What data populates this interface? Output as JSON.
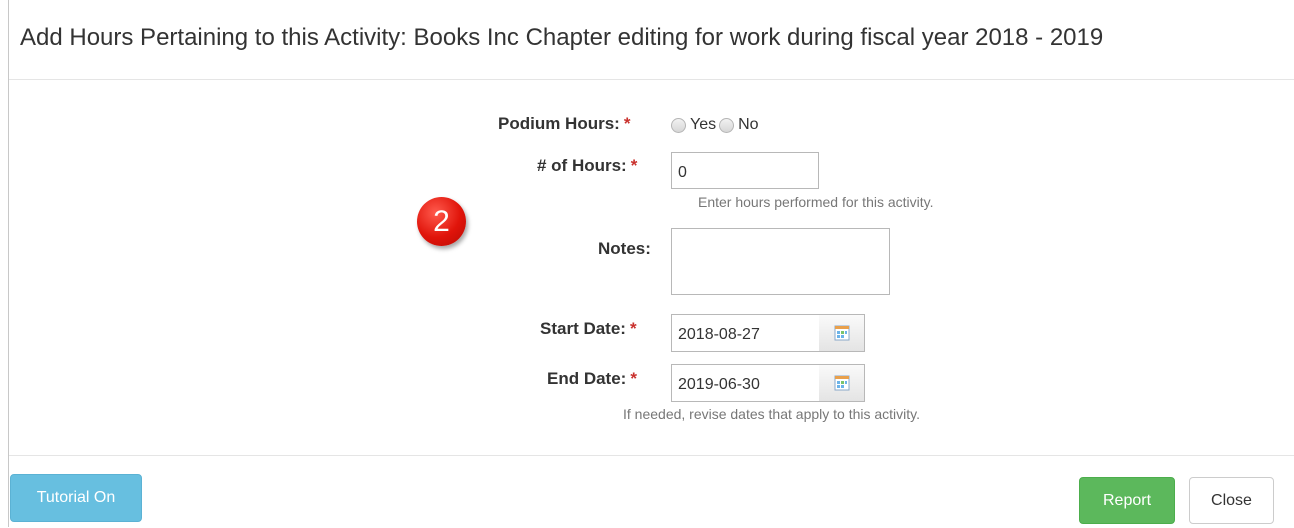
{
  "header": {
    "title": "Add Hours Pertaining to this Activity: Books Inc Chapter editing for work during fiscal year 2018 - 2019"
  },
  "form": {
    "required_marker": "*",
    "podium": {
      "label": "Podium Hours:",
      "options": [
        "Yes",
        "No"
      ]
    },
    "hours": {
      "label": "# of Hours:",
      "value": "0",
      "help": "Enter hours performed for this activity."
    },
    "notes": {
      "label": "Notes:",
      "value": ""
    },
    "start_date": {
      "label": "Start Date:",
      "value": "2018-08-27"
    },
    "end_date": {
      "label": "End Date:",
      "value": "2019-06-30",
      "help": "If needed, revise dates that apply to this activity."
    }
  },
  "step_badge": "2",
  "footer": {
    "tutorial_label": "Tutorial On",
    "report_label": "Report",
    "close_label": "Close"
  },
  "colors": {
    "tutorial": "#67bfe0",
    "report": "#5cb85c",
    "required": "#c9302c",
    "badge": "#e0140a"
  }
}
